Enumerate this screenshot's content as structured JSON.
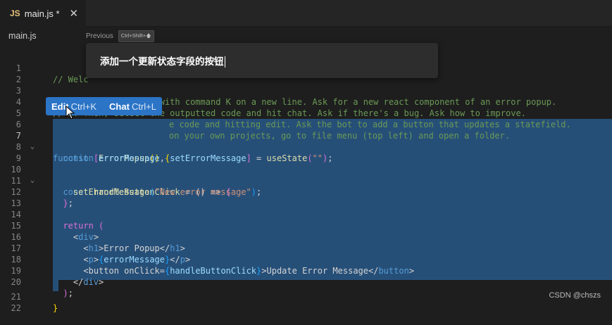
{
  "tab": {
    "icon": "JS",
    "title": "main.js *",
    "close": "✕"
  },
  "breadcrumb": "main.js",
  "prev_hint": {
    "label": "Previous",
    "shortcut": "Ctrl+Shift+🡅"
  },
  "prompt": {
    "text": "添加一个更新状态字段的按钮"
  },
  "actions": {
    "edit_label": "Edit",
    "edit_shortcut": "Ctrl+K",
    "chat_label": "Chat",
    "chat_shortcut": "Ctrl+L"
  },
  "line_numbers": [
    "1",
    "2",
    "3",
    "4",
    "5",
    "6",
    "7",
    "8",
    "9",
    "10",
    "11",
    "12",
    "13",
    "14",
    "15",
    "16",
    "17",
    "18",
    "19",
    "20",
    "21",
    "22"
  ],
  "active_line": "7",
  "code": {
    "l1": "// Welc",
    "l3": "// 1. Try generating with command K on a new line. Ask for a new react component of an error popup.",
    "l4": "// 2. Then, select the outputted code and hit chat. Ask if there's a bug. Ask how to improve.",
    "l5": "e code and hitting edit. Ask the bot to add a button that updates a statefield.",
    "l6": "on your own projects, go to file menu (top left) and open a folder."
  },
  "tokens": {
    "function": "function",
    "ErrorPopup": "ErrorPopup",
    "parens": "()",
    "brace_open": "{",
    "const": "const",
    "bracket_open": "[",
    "errorMessage": "errorMessage",
    "comma": ",",
    "setErrorMessage": "setErrorMessage",
    "bracket_close": "]",
    "eq_usestate": " = ",
    "useState": "useState",
    "paren_open": "(",
    "empty_string": "\"\"",
    "paren_close": ")",
    "semi": ";",
    "handleButtonClick": "handleButtonClick",
    "arrow": " = () => ",
    "new_error_message": "\"New error message\"",
    "brace_close": "}",
    "return": "return",
    "lt": "<",
    "gt": ">",
    "lt_slash": "</",
    "div": "div",
    "h1": "h1",
    "h1_text": "Error Popup",
    "p": "p",
    "button_open": "button onClick=",
    "button": "button",
    "button_text": "Update Error Message"
  },
  "watermark": "CSDN @chszs",
  "colors": {
    "selection": "#264f78",
    "accent": "#2b74c6",
    "background": "#1e1e1e"
  }
}
